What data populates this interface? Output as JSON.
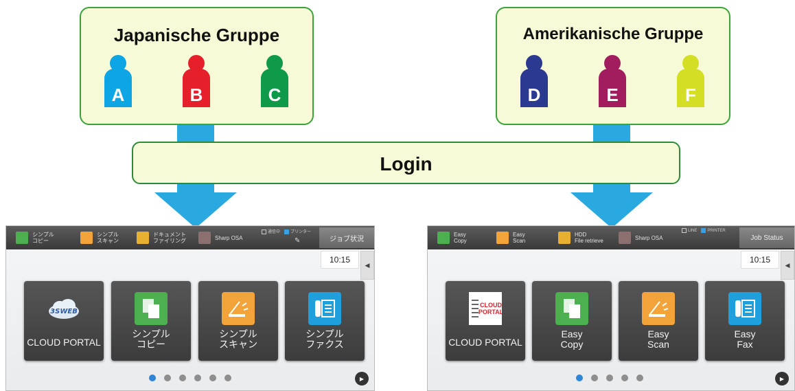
{
  "groups": {
    "japanese": {
      "title": "Japanische Gruppe",
      "users": [
        {
          "letter": "A",
          "color": "#0ea5e4"
        },
        {
          "letter": "B",
          "color": "#e5202a"
        },
        {
          "letter": "C",
          "color": "#0e9a48"
        }
      ]
    },
    "american": {
      "title": "Amerikanische Gruppe",
      "users": [
        {
          "letter": "D",
          "color": "#2b3990"
        },
        {
          "letter": "E",
          "color": "#a11d5e"
        },
        {
          "letter": "F",
          "color": "#d4de24"
        }
      ]
    }
  },
  "login": {
    "label": "Login"
  },
  "colors": {
    "arrow": "#2aa8e0",
    "box_fill": "#f7fad6",
    "box_border": "#3aa33a"
  },
  "screens": {
    "japanese": {
      "toolbar": [
        {
          "label": "シンプル\nコピー",
          "icon": "copy-icon",
          "color": "#4caf50"
        },
        {
          "label": "シンプル\nスキャン",
          "icon": "scan-icon",
          "color": "#f2a33a"
        },
        {
          "label": "ドキュメント\nファイリング",
          "icon": "folder-icon",
          "color": "#e8b030"
        },
        {
          "label": "Sharp OSA",
          "icon": "osa-icon",
          "color": "#8c6f6f"
        }
      ],
      "status": [
        "通信中",
        "プリンター"
      ],
      "job_status": "ジョブ状況",
      "time": "10:15",
      "side_tab": "◀",
      "tiles": [
        {
          "label": "CLOUD PORTAL",
          "icon": "3sweb-cloud-icon"
        },
        {
          "label": "シンプル\nコピー",
          "icon": "copy-icon"
        },
        {
          "label": "シンプル\nスキャン",
          "icon": "scan-icon"
        },
        {
          "label": "シンプル\nファクス",
          "icon": "fax-icon"
        }
      ],
      "pages": 6,
      "current_page": 1,
      "next": "▶"
    },
    "american": {
      "toolbar": [
        {
          "label": "Easy\nCopy",
          "icon": "copy-icon",
          "color": "#4caf50"
        },
        {
          "label": "Easy\nScan",
          "icon": "scan-icon",
          "color": "#f2a33a"
        },
        {
          "label": "HDD\nFile retrieve",
          "icon": "folder-icon",
          "color": "#e8b030"
        },
        {
          "label": "Sharp OSA",
          "icon": "osa-icon",
          "color": "#8c6f6f"
        }
      ],
      "status": [
        "LINE",
        "PRINTER"
      ],
      "job_status": "Job Status",
      "time": "10:15",
      "side_tab": "◀",
      "tiles": [
        {
          "label": "CLOUD PORTAL",
          "icon": "cloud-portal-icon",
          "icon_text": "CLOUD\nPORTAL"
        },
        {
          "label": "Easy\nCopy",
          "icon": "copy-icon"
        },
        {
          "label": "Easy\nScan",
          "icon": "scan-icon"
        },
        {
          "label": "Easy\nFax",
          "icon": "fax-icon"
        }
      ],
      "pages": 5,
      "current_page": 1,
      "next": "▶"
    }
  }
}
